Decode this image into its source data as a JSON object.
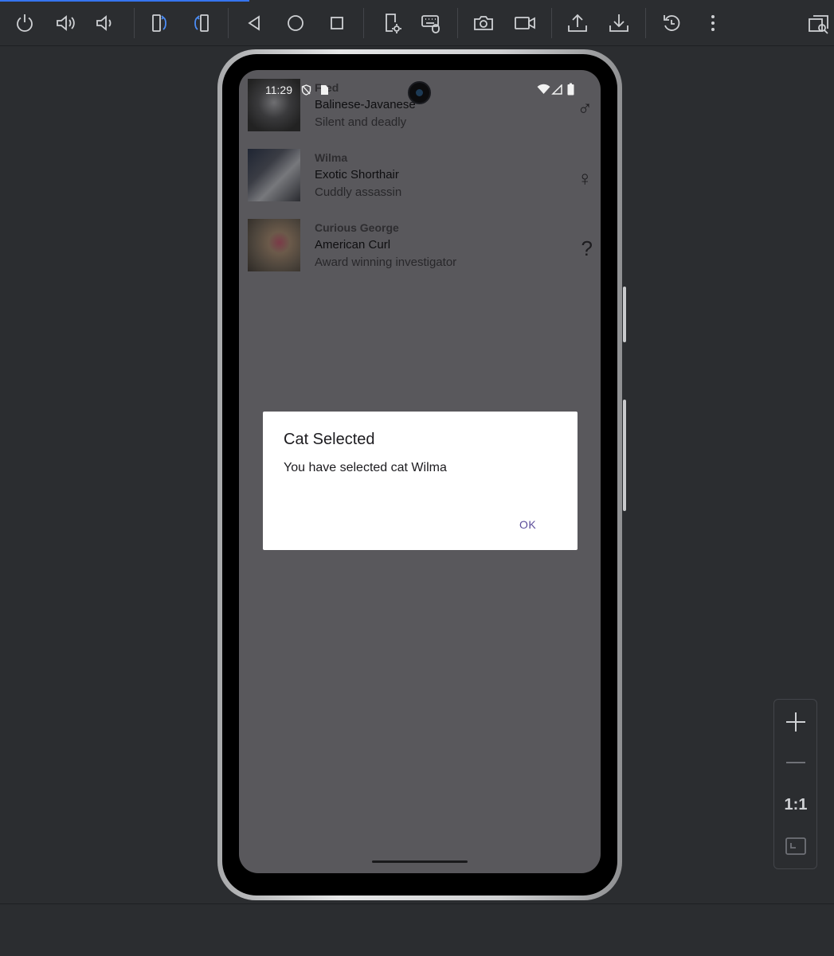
{
  "toolbar": {
    "icons": [
      "power-icon",
      "volume-up-icon",
      "volume-down-icon",
      "rotate-left-icon",
      "rotate-right-icon",
      "back-icon",
      "home-icon",
      "overview-icon",
      "device-settings-icon",
      "keyboard-mouse-icon",
      "screenshot-icon",
      "screen-record-icon",
      "upload-icon",
      "download-icon",
      "reset-icon",
      "more-icon",
      "inspect-window-icon"
    ]
  },
  "status_bar": {
    "time": "11:29"
  },
  "cats": [
    {
      "name": "Fred",
      "breed": "Balinese-Javanese",
      "description": "Silent and deadly",
      "gender_symbol": "♂"
    },
    {
      "name": "Wilma",
      "breed": "Exotic Shorthair",
      "description": "Cuddly assassin",
      "gender_symbol": "♀"
    },
    {
      "name": "Curious George",
      "breed": "American Curl",
      "description": "Award winning investigator",
      "gender_symbol": "?"
    }
  ],
  "dialog": {
    "title": "Cat Selected",
    "message": "You have selected cat Wilma",
    "ok_label": "OK"
  },
  "zoom": {
    "ratio_label": "1:1"
  },
  "colors": {
    "accent": "#3574f0",
    "dialog_button": "#5b4c9a",
    "scrim_screen": "#59585c"
  }
}
